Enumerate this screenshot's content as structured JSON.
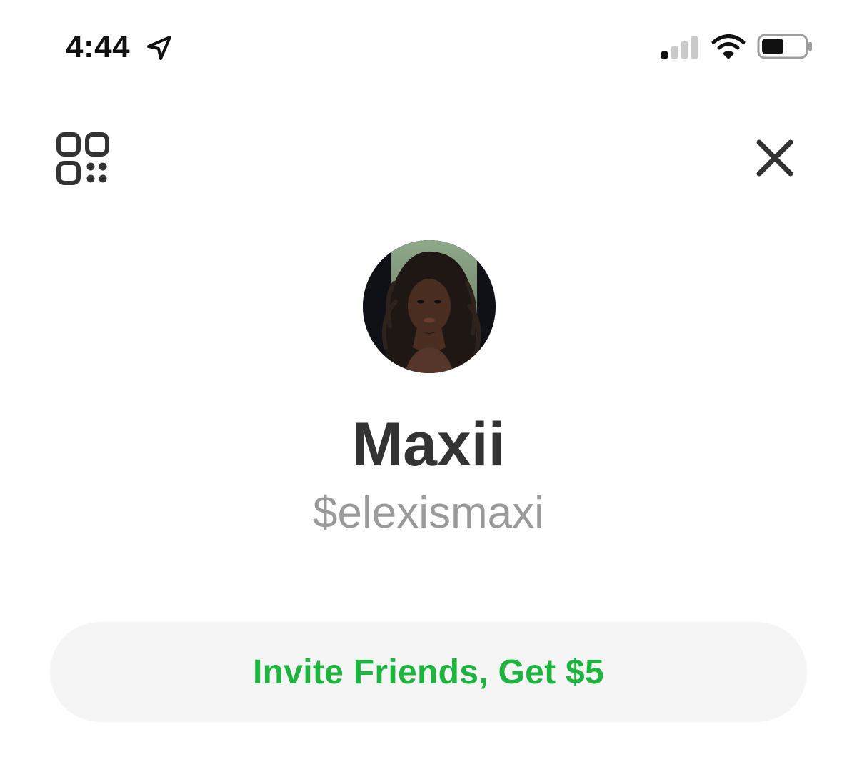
{
  "status_bar": {
    "time": "4:44",
    "location_icon": "location-arrow-icon",
    "signal_icon": "cellular-signal-icon",
    "signal_bars_active": 1,
    "signal_bars_total": 4,
    "wifi_icon": "wifi-icon",
    "battery_icon": "battery-icon",
    "battery_level": 0.5
  },
  "nav": {
    "qr_icon": "qr-code-icon",
    "close_icon": "close-icon"
  },
  "profile": {
    "name": "Maxii",
    "handle": "$elexismaxi",
    "avatar": "profile-photo"
  },
  "invite": {
    "label": "Invite Friends, Get $5"
  },
  "colors": {
    "background": "#ffffff",
    "primary_text": "#333333",
    "handle_text": "#9a9a9a",
    "invite_green": "#1fb33f",
    "invite_background": "#f5f5f5"
  }
}
